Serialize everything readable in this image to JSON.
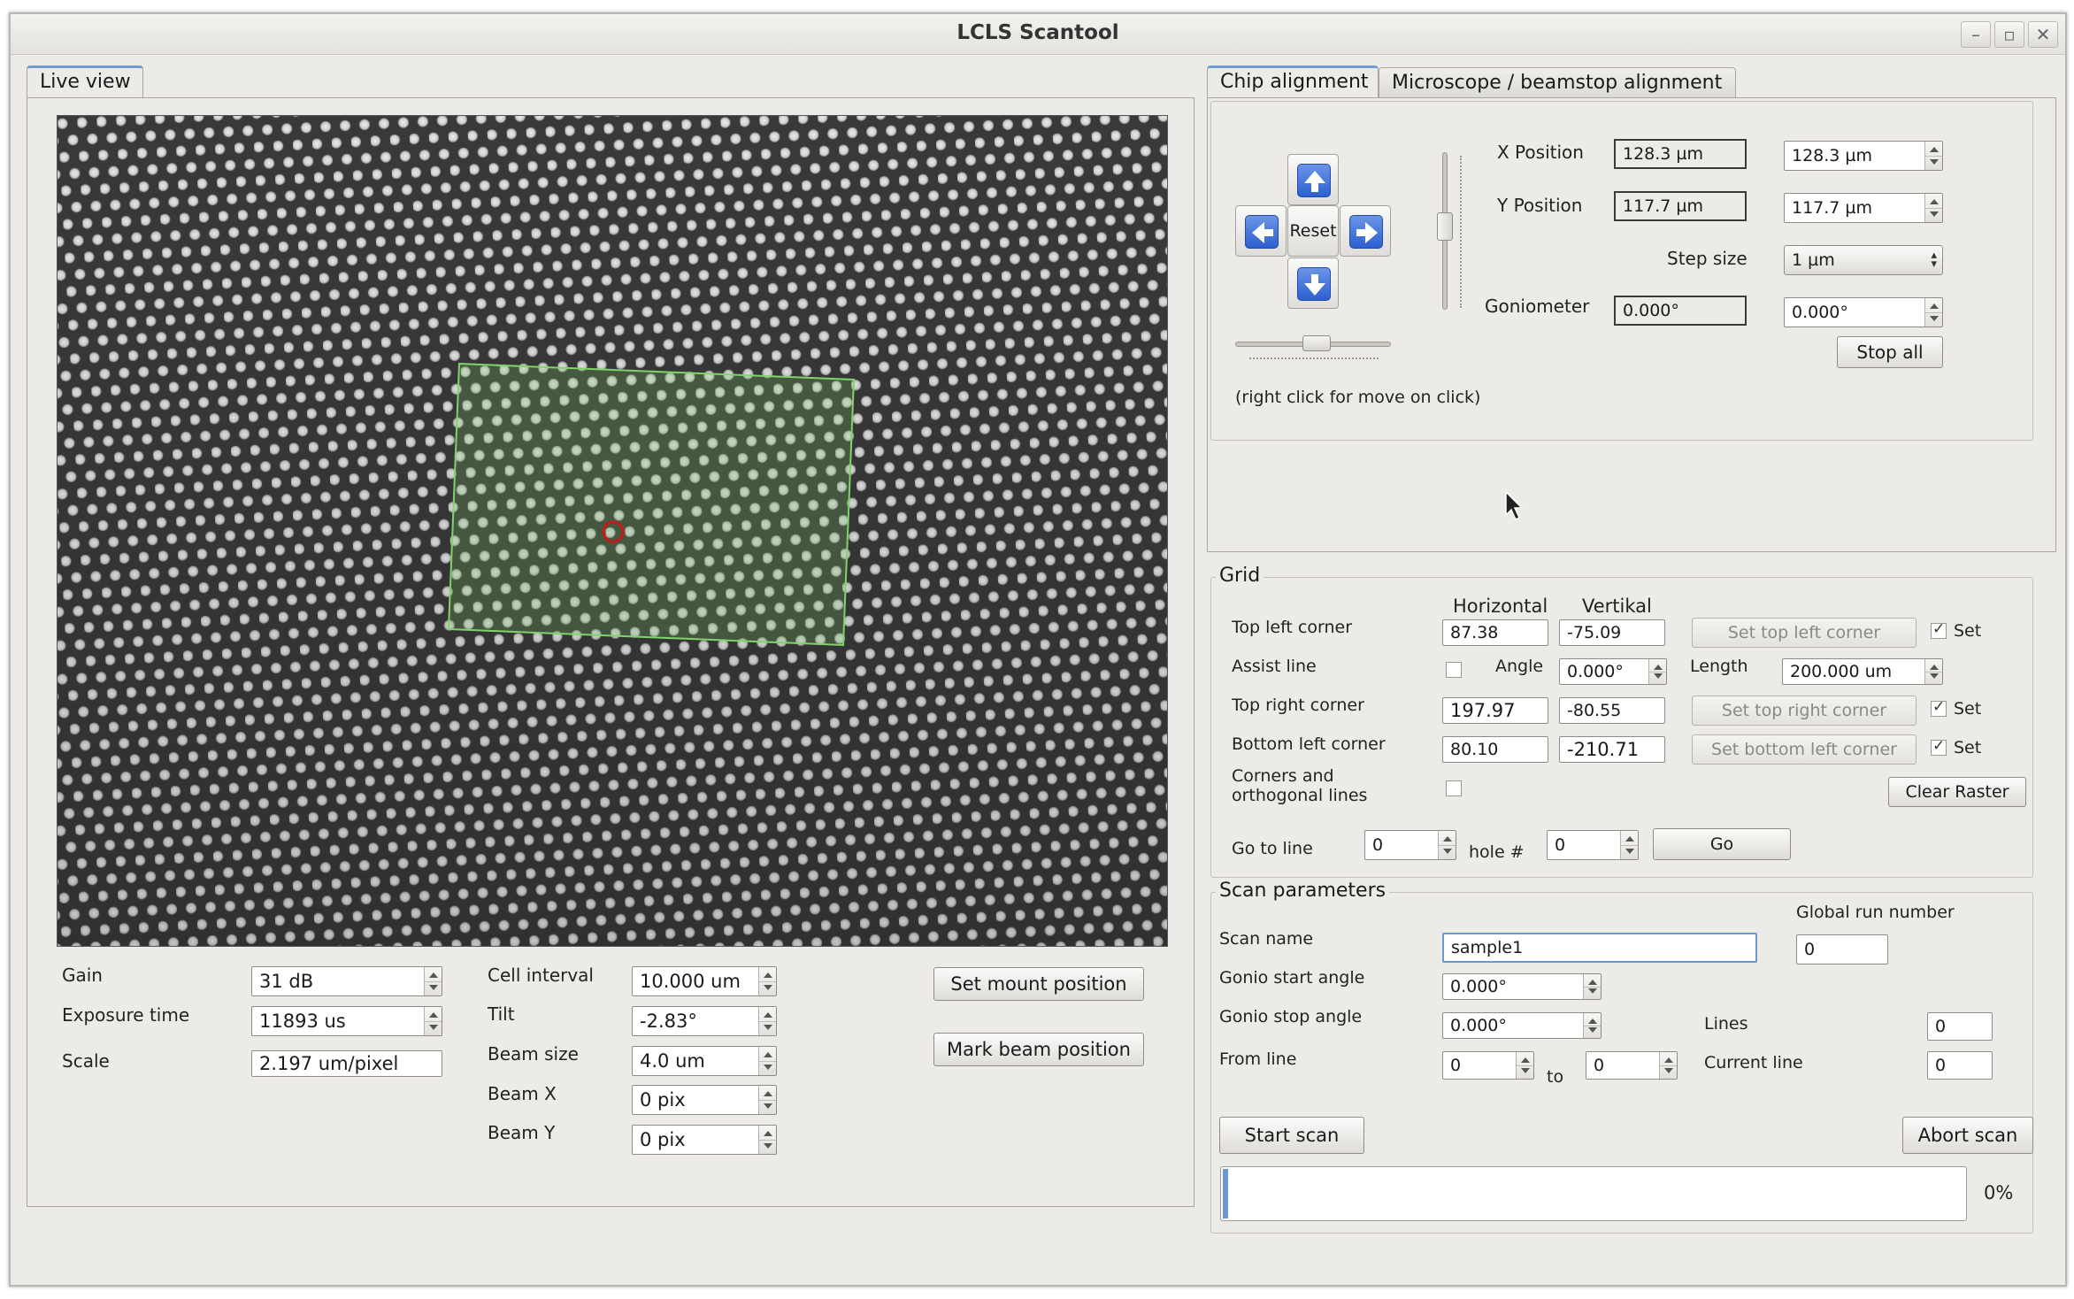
{
  "window": {
    "title": "LCLS Scantool",
    "minimize": "–",
    "maximize": "▫",
    "close": "✕"
  },
  "left_tab": {
    "label": "Live view"
  },
  "camera": {
    "gain_label": "Gain",
    "gain_value": "31 dB",
    "exposure_label": "Exposure time",
    "exposure_value": "11893 us",
    "scale_label": "Scale",
    "scale_value": "2.197 um/pixel",
    "cell_interval_label": "Cell interval",
    "cell_interval_value": "10.000 um",
    "tilt_label": "Tilt",
    "tilt_value": "-2.83°",
    "beam_size_label": "Beam size",
    "beam_size_value": "4.0 um",
    "beam_x_label": "Beam X",
    "beam_x_value": "0 pix",
    "beam_y_label": "Beam Y",
    "beam_y_value": "0 pix",
    "set_mount_label": "Set mount position",
    "mark_beam_label": "Mark beam position"
  },
  "right_tabs": {
    "chip": "Chip alignment",
    "microscope": "Microscope / beamstop alignment"
  },
  "alignment": {
    "reset_label": "Reset",
    "x_label": "X Position",
    "x_readback": "128.3 µm",
    "x_set": "128.3 µm",
    "y_label": "Y Position",
    "y_readback": "117.7 µm",
    "y_set": "117.7 µm",
    "step_label": "Step size",
    "step_value": "1 µm",
    "gonio_label": "Goniometer",
    "gonio_readback": "0.000°",
    "gonio_set": "0.000°",
    "stop_all_label": "Stop all",
    "hint": "(right click for move on click)"
  },
  "grid": {
    "title": "Grid",
    "col_horizontal": "Horizontal",
    "col_vertical": "Vertikal",
    "tl_label": "Top left corner",
    "tl_h": "87.38",
    "tl_v": "-75.09",
    "tl_button": "Set top left corner",
    "assist_label": "Assist line",
    "angle_label": "Angle",
    "angle_value": "0.000°",
    "length_label": "Length",
    "length_value": "200.000 um",
    "tr_label": "Top right corner",
    "tr_h": "197.97",
    "tr_v": "-80.55",
    "tr_button": "Set top right corner",
    "bl_label": "Bottom left corner",
    "bl_h": "80.10",
    "bl_v": "-210.71",
    "bl_button": "Set bottom left corner",
    "set_label": "Set",
    "corners_label_1": "Corners and",
    "corners_label_2": "orthogonal lines",
    "clear_raster_label": "Clear Raster",
    "goto_label": "Go to line",
    "goto_line": "0",
    "hole_label": "hole #",
    "hole_value": "0",
    "go_label": "Go"
  },
  "scan": {
    "title": "Scan parameters",
    "global_run_label": "Global run number",
    "global_run_value": "0",
    "name_label": "Scan name",
    "name_value": "sample1",
    "gonio_start_label": "Gonio start angle",
    "gonio_start_value": "0.000°",
    "gonio_stop_label": "Gonio stop angle",
    "gonio_stop_value": "0.000°",
    "lines_label": "Lines",
    "lines_value": "0",
    "from_label": "From line",
    "from_value": "0",
    "to_label": "to",
    "to_value": "0",
    "current_line_label": "Current line",
    "current_line_value": "0",
    "start_label": "Start scan",
    "abort_label": "Abort scan",
    "progress_text": "0%",
    "progress_fraction": 0.0
  },
  "colors": {
    "accent": "#6d98cf",
    "roi": "#7fd36a",
    "beam_marker": "#c81818",
    "nav_blue": "#2d5fcf"
  }
}
